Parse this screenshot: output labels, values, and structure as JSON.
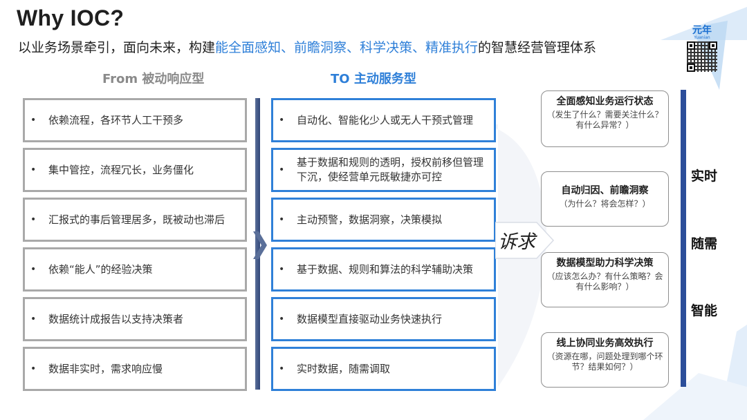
{
  "header": {
    "title": "Why IOC?",
    "subtitle_pre": "以业务场景牵引，面向未来，构建",
    "subtitle_highlight": "能全面感知、前瞻洞察、科学决策、精准执行",
    "subtitle_post": "的智慧经营管理体系"
  },
  "logo": {
    "text": "元年",
    "sub": "Yuanian"
  },
  "from_column": {
    "heading": "From 被动响应型",
    "items": [
      "依赖流程，各环节人工干预多",
      "集中管控，流程冗长，业务僵化",
      "汇报式的事后管理居多，既被动也滞后",
      "依赖“能人”的经验决策",
      "数据统计成报告以支持决策者",
      "数据非实时，需求响应慢"
    ]
  },
  "to_column": {
    "heading": "TO 主动服务型",
    "items": [
      "自动化、智能化少人或无人干预式管理",
      "基于数据和规则的透明，授权前移但管理下沉，使经营单元既敏捷亦可控",
      "主动预警，数据洞察，决策模拟",
      "基于数据、规则和算法的科学辅助决策",
      "数据模型直接驱动业务快速执行",
      "实时数据，随需调取"
    ]
  },
  "bullet": "•",
  "appeal": "诉求",
  "capabilities": [
    {
      "title": "全面感知业务运行状态",
      "desc": "（发生了什么？需要关注什么？有什么异常？）"
    },
    {
      "title": "自动归因、前瞻洞察",
      "desc": "（为什么？将会怎样？）"
    },
    {
      "title": "数据模型助力科学决策",
      "desc": "（应该怎么办？有什么策略？会有什么影响？）"
    },
    {
      "title": "线上协同业务高效执行",
      "desc": "（资源在哪，问题处理到哪个环节？结果如何？）"
    }
  ],
  "attributes": [
    "实时",
    "随需",
    "智能"
  ],
  "colors": {
    "accent_blue": "#2e7fd8",
    "box_blue_border": "#2f80d8",
    "box_grey_border": "#a9a9a9",
    "bar_navy": "#2c4e9a"
  }
}
